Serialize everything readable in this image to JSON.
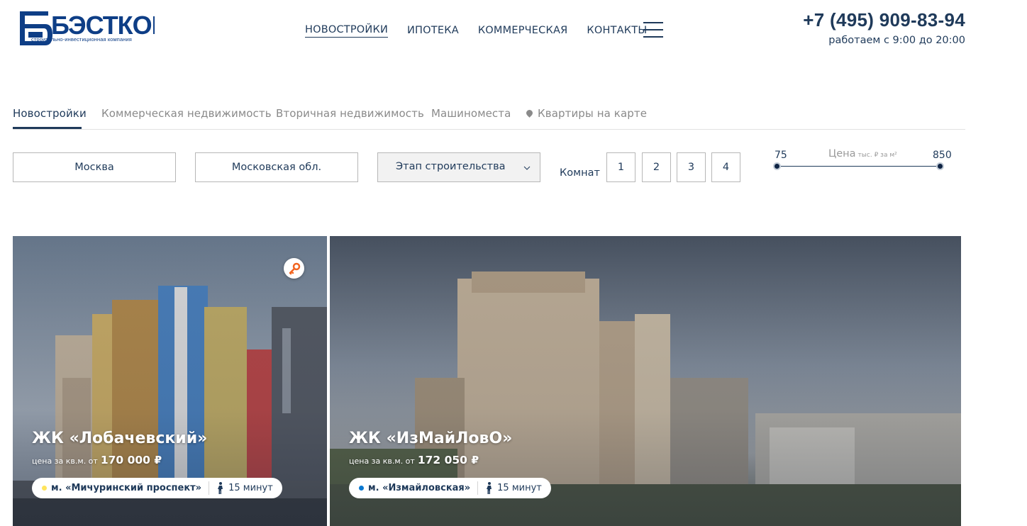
{
  "header": {
    "logo_text": "БЭСТКОН",
    "logo_subtitle": "строительно-инвестиционная компания",
    "nav": [
      {
        "label": "НОВОСТРОЙКИ",
        "active": true
      },
      {
        "label": "ИПОТЕКА",
        "active": false
      },
      {
        "label": "КОММЕРЧЕСКАЯ",
        "active": false
      },
      {
        "label": "КОНТАКТЫ",
        "active": false
      }
    ],
    "menu_icon": "hamburger-menu-icon",
    "phone": "+7 (495) 909-83-94",
    "hours": "работаем с 9:00 до 20:00"
  },
  "tabs": [
    {
      "label": "Новостройки",
      "active": true
    },
    {
      "label": "Коммерческая недвижимость",
      "active": false
    },
    {
      "label": "Вторичная недвижимость",
      "active": false
    },
    {
      "label": "Машиноместа",
      "active": false
    },
    {
      "label": "Квартиры на карте",
      "active": false,
      "icon": "map-pin-icon"
    }
  ],
  "filters": {
    "region_1": "Москва",
    "region_2": "Московская обл.",
    "stage_select": "Этап строительства",
    "rooms_label": "Комнат",
    "rooms": [
      "1",
      "2",
      "3",
      "4"
    ],
    "price": {
      "label": "Цена",
      "unit": "тыс. ₽ за м²",
      "min": "75",
      "max": "850",
      "selected_fraction": [
        0,
        1
      ]
    }
  },
  "cards": [
    {
      "title": "ЖК «Лобачевский»",
      "price_label": "цена за кв.м. от",
      "price_value": "170 000 ₽",
      "metro": "м. «Мичуринский проспект»",
      "metro_color": "#ffe45c",
      "walk_time": "15 минут",
      "badge_icon": "key-icon"
    },
    {
      "title": "ЖК «ИзМайЛовО»",
      "price_label": "цена за кв.м. от",
      "price_value": "172 050 ₽",
      "metro": "м. «Измайловская»",
      "metro_color": "#0a78d0",
      "walk_time": "15 минут"
    }
  ],
  "colors": {
    "primary": "#1f3a5a",
    "logo": "#0e3e86",
    "key_badge": "#f26522"
  }
}
